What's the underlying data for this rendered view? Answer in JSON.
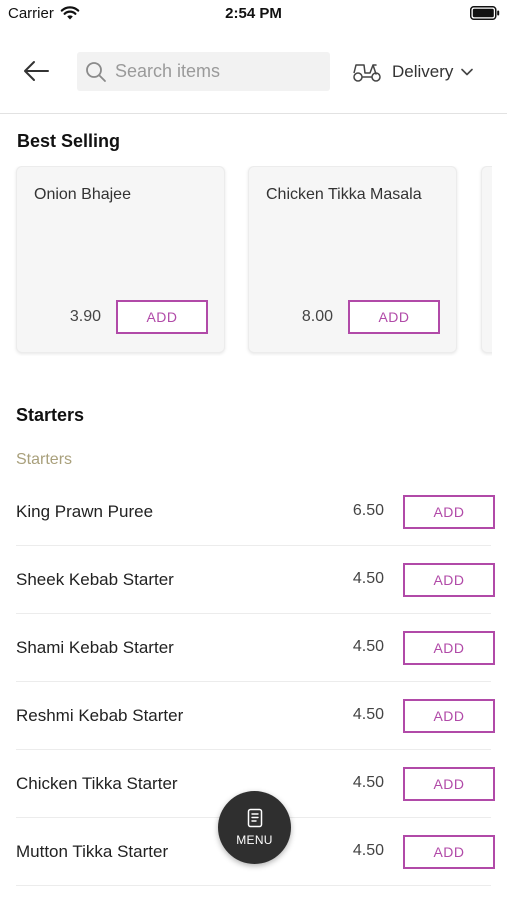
{
  "status_bar": {
    "carrier": "Carrier",
    "time": "2:54 PM"
  },
  "header": {
    "search_placeholder": "Search items",
    "delivery_label": "Delivery"
  },
  "best_selling": {
    "title": "Best Selling",
    "items": [
      {
        "name": "Onion Bhajee",
        "price": "3.90",
        "add_label": "ADD"
      },
      {
        "name": "Chicken Tikka Masala",
        "price": "8.00",
        "add_label": "ADD"
      }
    ]
  },
  "starters": {
    "title": "Starters",
    "category_label": "Starters",
    "items": [
      {
        "name": "King Prawn Puree",
        "price": "6.50",
        "add_label": "ADD"
      },
      {
        "name": "Sheek Kebab Starter",
        "price": "4.50",
        "add_label": "ADD"
      },
      {
        "name": "Shami Kebab Starter",
        "price": "4.50",
        "add_label": "ADD"
      },
      {
        "name": "Reshmi Kebab Starter",
        "price": "4.50",
        "add_label": "ADD"
      },
      {
        "name": "Chicken Tikka Starter",
        "price": "4.50",
        "add_label": "ADD"
      },
      {
        "name": "Mutton Tikka Starter",
        "price": "4.50",
        "add_label": "ADD"
      }
    ]
  },
  "fab": {
    "label": "MENU"
  },
  "colors": {
    "accent": "#b14aa8",
    "category_text": "#a9a07c",
    "fab_background": "#2f2f2f"
  }
}
